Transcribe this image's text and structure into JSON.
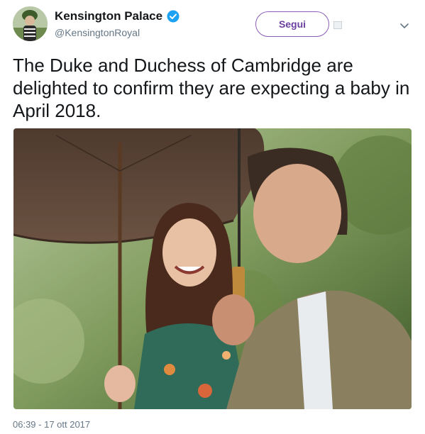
{
  "header": {
    "display_name": "Kensington Palace",
    "handle": "@KensingtonRoyal",
    "verified_icon": "verified-badge-icon",
    "follow_label": "Segui",
    "menu_icon": "chevron-down-icon"
  },
  "tweet": {
    "text": "The Duke and Duchess of Cambridge are delighted to confirm they are expecting a baby in April 2018.",
    "timestamp": "06:39 - 17 ott 2017"
  },
  "colors": {
    "follow_accent": "#6b3fa0",
    "verified": "#1da1f2",
    "muted_text": "#657786"
  }
}
